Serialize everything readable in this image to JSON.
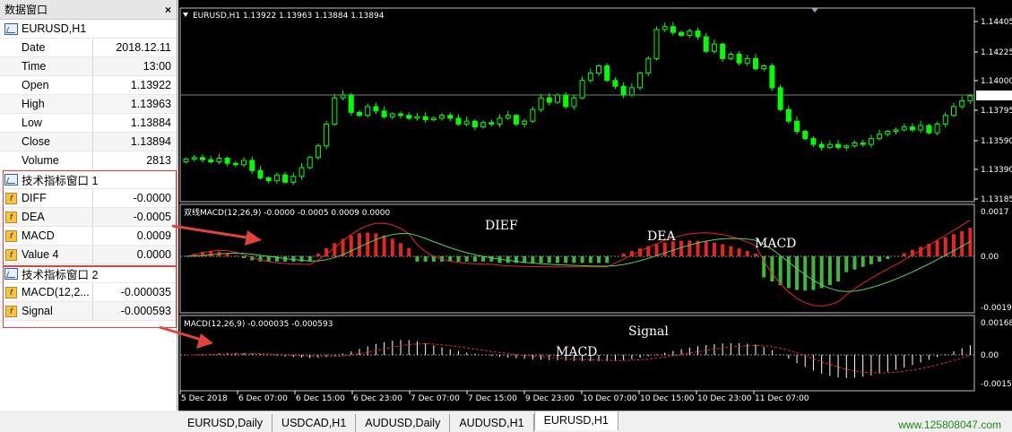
{
  "data_window": {
    "title": "数据窗口",
    "close": "×",
    "symbol": "EURUSD,H1",
    "rows": [
      {
        "label": "Date",
        "value": "2018.12.11"
      },
      {
        "label": "Time",
        "value": "13:00"
      },
      {
        "label": "Open",
        "value": "1.13922"
      },
      {
        "label": "High",
        "value": "1.13963"
      },
      {
        "label": "Low",
        "value": "1.13884"
      },
      {
        "label": "Close",
        "value": "1.13894"
      },
      {
        "label": "Volume",
        "value": "2813"
      }
    ],
    "section1": {
      "title": "技术指标窗口 1",
      "rows": [
        {
          "label": "DIFF",
          "value": "-0.0000"
        },
        {
          "label": "DEA",
          "value": "-0.0005"
        },
        {
          "label": "MACD",
          "value": "0.0009"
        },
        {
          "label": "Value 4",
          "value": "0.0000"
        }
      ]
    },
    "section2": {
      "title": "技术指标窗口 2",
      "rows": [
        {
          "label": "MACD(12,2...",
          "value": "-0.000035"
        },
        {
          "label": "Signal",
          "value": "-0.000593"
        }
      ]
    }
  },
  "chart": {
    "main_header": "EURUSD,H1  1.13922 1.13963 1.13884 1.13894",
    "price_axis": [
      "1.14405",
      "1.14225",
      "1.14000",
      "1.13795",
      "1.13590",
      "1.13390",
      "1.13185"
    ],
    "current_price": "1.13894",
    "sub1_header": "双线MACD(12,26,9) -0.0000 -0.0005 0.0009 0.0000",
    "sub1_axis": [
      "0.0017",
      "0.00",
      "-0.0019"
    ],
    "sub2_header": "MACD(12,26,9) -0.000035 -0.000593",
    "sub2_axis": [
      "0.001684",
      "0.00",
      "-0.001502"
    ],
    "time_axis": [
      "5 Dec 2018",
      "6 Dec 07:00",
      "6 Dec 15:00",
      "6 Dec 23:00",
      "7 Dec 07:00",
      "7 Dec 15:00",
      "9 Dec 23:00",
      "10 Dec 07:00",
      "10 Dec 15:00",
      "10 Dec 23:00",
      "11 Dec 07:00"
    ],
    "annotations": {
      "diff": "DIEF",
      "dea": "DEA",
      "macd1": "MACD",
      "signal": "Signal",
      "macd2": "MACD"
    },
    "colors": {
      "bull": "#00ff00",
      "bear": "#00ff00",
      "up_hist": "#e8251f",
      "down_hist": "#3db83d",
      "diff_line": "#e8251f",
      "dea_line": "#4fd44f",
      "signal": "#e8251f",
      "grid_line": "#808080"
    }
  },
  "tabs": [
    {
      "label": "EURUSD,Daily",
      "active": false
    },
    {
      "label": "USDCAD,H1",
      "active": false
    },
    {
      "label": "AUDUSD,Daily",
      "active": false
    },
    {
      "label": "AUDUSD,H1",
      "active": false
    },
    {
      "label": "EURUSD,H1",
      "active": true
    }
  ],
  "watermark": "www.125808047.com"
}
